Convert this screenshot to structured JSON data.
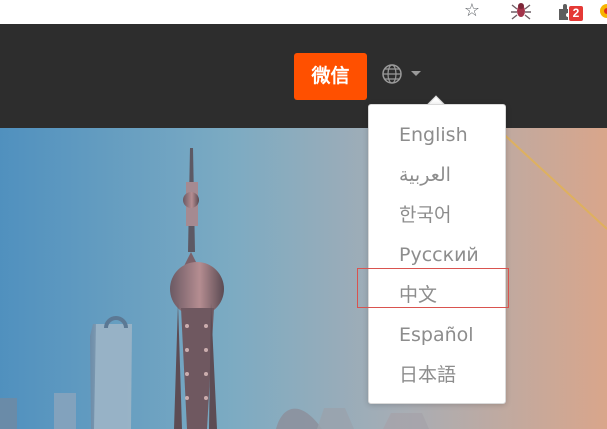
{
  "browser_toolbar": {
    "bookmark_icon": "star-outline-icon",
    "extension_icons": [
      "spider-extension-icon",
      "puzzle-extension-icon",
      "yellow-extension-icon"
    ],
    "extension_badge": "2"
  },
  "site_header": {
    "wechat_label": "微信",
    "language_icon": "globe-icon",
    "dropdown_icon": "caret-down-icon",
    "button_color": "#ff5000",
    "header_color": "#2d2d2d"
  },
  "language_menu": {
    "options": [
      "English",
      "العربية",
      "한국어",
      "Русский",
      "中文",
      "Español",
      "日本語"
    ],
    "highlighted_option": "中文",
    "highlight_color": "#d9534f"
  },
  "hero": {
    "image_subject": ""
  }
}
